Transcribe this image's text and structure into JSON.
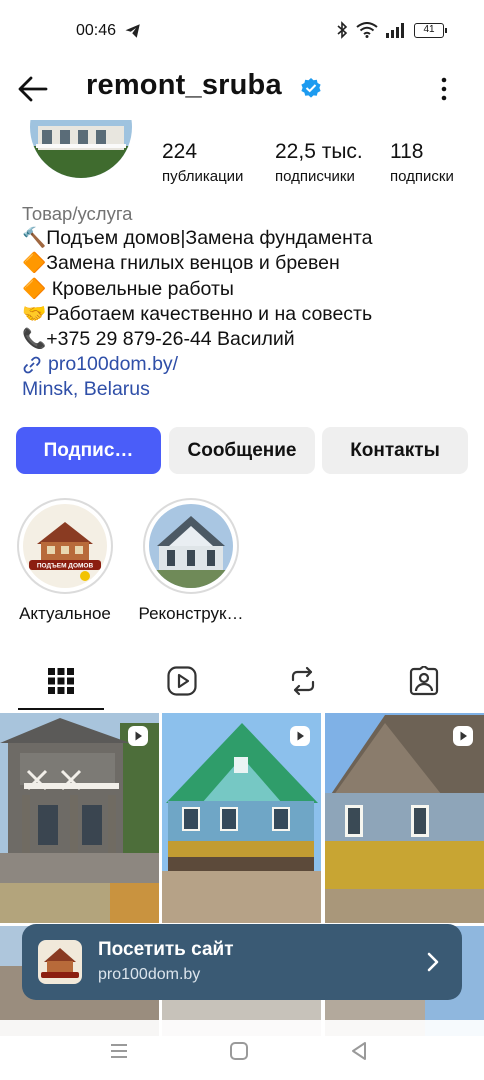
{
  "status_bar": {
    "time": "00:46",
    "battery": "41"
  },
  "header": {
    "username": "remont_sruba"
  },
  "stats": [
    {
      "value": "224",
      "label": "публикации"
    },
    {
      "value": "22,5 тыс.",
      "label": "подписчики"
    },
    {
      "value": "118",
      "label": "подписки"
    }
  ],
  "bio": {
    "category": "Товар/услуга",
    "lines": [
      "🔨Подъем домов|Замена фундамента",
      "🔶Замена гнилых венцов и бревен",
      "🔶 Кровельные работы",
      "🤝Работаем качественно и на совесть",
      "📞+375 29 879-26-44 Василий"
    ],
    "link": "pro100dom.by/",
    "location": "Minsk, Belarus"
  },
  "buttons": {
    "follow": "Подпис…",
    "message": "Сообщение",
    "contacts": "Контакты"
  },
  "highlights": [
    {
      "label": "Актуальное",
      "badge_text": "ПОДЪЕМ ДОМОВ"
    },
    {
      "label": "Реконструк…"
    }
  ],
  "visit_site": {
    "title": "Посетить сайт",
    "url": "pro100dom.by"
  },
  "colors": {
    "primary_button": "#4a5df9",
    "link": "#2f4fa8",
    "banner": "#3a5a74"
  }
}
